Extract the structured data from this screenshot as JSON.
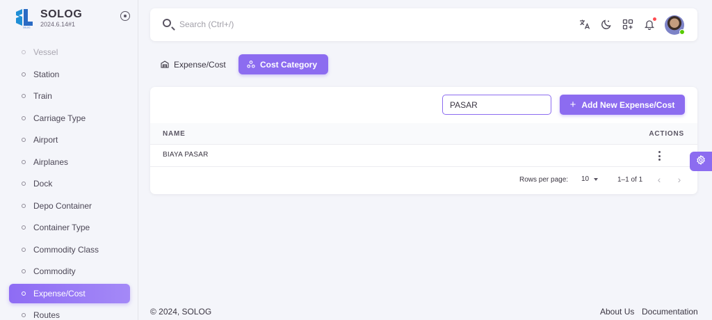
{
  "brand": {
    "name": "SOLOG",
    "version": "2024.6.14#1"
  },
  "sidebar": {
    "items": [
      {
        "label": "Vessel"
      },
      {
        "label": "Station"
      },
      {
        "label": "Train"
      },
      {
        "label": "Carriage Type"
      },
      {
        "label": "Airport"
      },
      {
        "label": "Airplanes"
      },
      {
        "label": "Dock"
      },
      {
        "label": "Depo Container"
      },
      {
        "label": "Container Type"
      },
      {
        "label": "Commodity Class"
      },
      {
        "label": "Commodity"
      },
      {
        "label": "Expense/Cost"
      },
      {
        "label": "Routes"
      }
    ],
    "active_index": 11
  },
  "topbar": {
    "search_placeholder": "Search (Ctrl+/)",
    "icons": [
      "translate-icon",
      "moon-icon",
      "apps-add-icon",
      "bell-icon",
      "avatar"
    ]
  },
  "tabs": [
    {
      "label": "Expense/Cost",
      "icon": "warehouse-icon",
      "active": false
    },
    {
      "label": "Cost Category",
      "icon": "category-icon",
      "active": true
    }
  ],
  "card": {
    "filter_value": "PASAR",
    "add_button_label": "Add New Expense/Cost",
    "columns": [
      "NAME",
      "ACTIONS"
    ],
    "rows": [
      {
        "name": "BIAYA PASAR"
      }
    ],
    "pagination": {
      "rows_per_page_label": "Rows per page:",
      "rows_per_page": "10",
      "range": "1–1 of 1"
    }
  },
  "footer": {
    "copyright": "© 2024, SOLOG",
    "links": [
      "About Us",
      "Documentation"
    ]
  },
  "colors": {
    "primary": "#8c6cf0",
    "background": "#f4f5fa",
    "text": "#3a3541",
    "online": "#56ca00",
    "badge": "#ff4c51"
  }
}
